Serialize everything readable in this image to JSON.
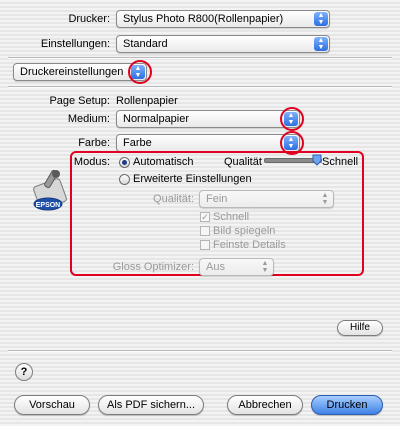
{
  "printer": {
    "label": "Drucker:",
    "value": "Stylus Photo R800(Rollenpapier)"
  },
  "settings": {
    "label": "Einstellungen:",
    "value": "Standard"
  },
  "panel_popup": {
    "value": "Druckereinstellungen"
  },
  "page_setup": {
    "label": "Page Setup:",
    "value": "Rollenpapier"
  },
  "medium": {
    "label": "Medium:",
    "value": "Normalpapier"
  },
  "color": {
    "label": "Farbe:",
    "value": "Farbe"
  },
  "mode": {
    "label": "Modus:",
    "automatic": "Automatisch",
    "advanced": "Erweiterte Einstellungen",
    "slider_left": "Qualität",
    "slider_right": "Schnell",
    "slider_value": 1.0
  },
  "advanced": {
    "quality_label": "Qualität:",
    "quality_value": "Fein",
    "fast": "Schnell",
    "mirror": "Bild spiegeln",
    "finest": "Feinste Details",
    "gloss_label": "Gloss Optimizer:",
    "gloss_value": "Aus"
  },
  "logo_text": "EPSON",
  "help_button": "Hilfe",
  "help_icon": "?",
  "buttons": {
    "preview": "Vorschau",
    "pdf": "Als PDF sichern...",
    "cancel": "Abbrechen",
    "print": "Drucken"
  },
  "colors": {
    "highlight": "#e00020",
    "accent": "#3f82e6"
  }
}
